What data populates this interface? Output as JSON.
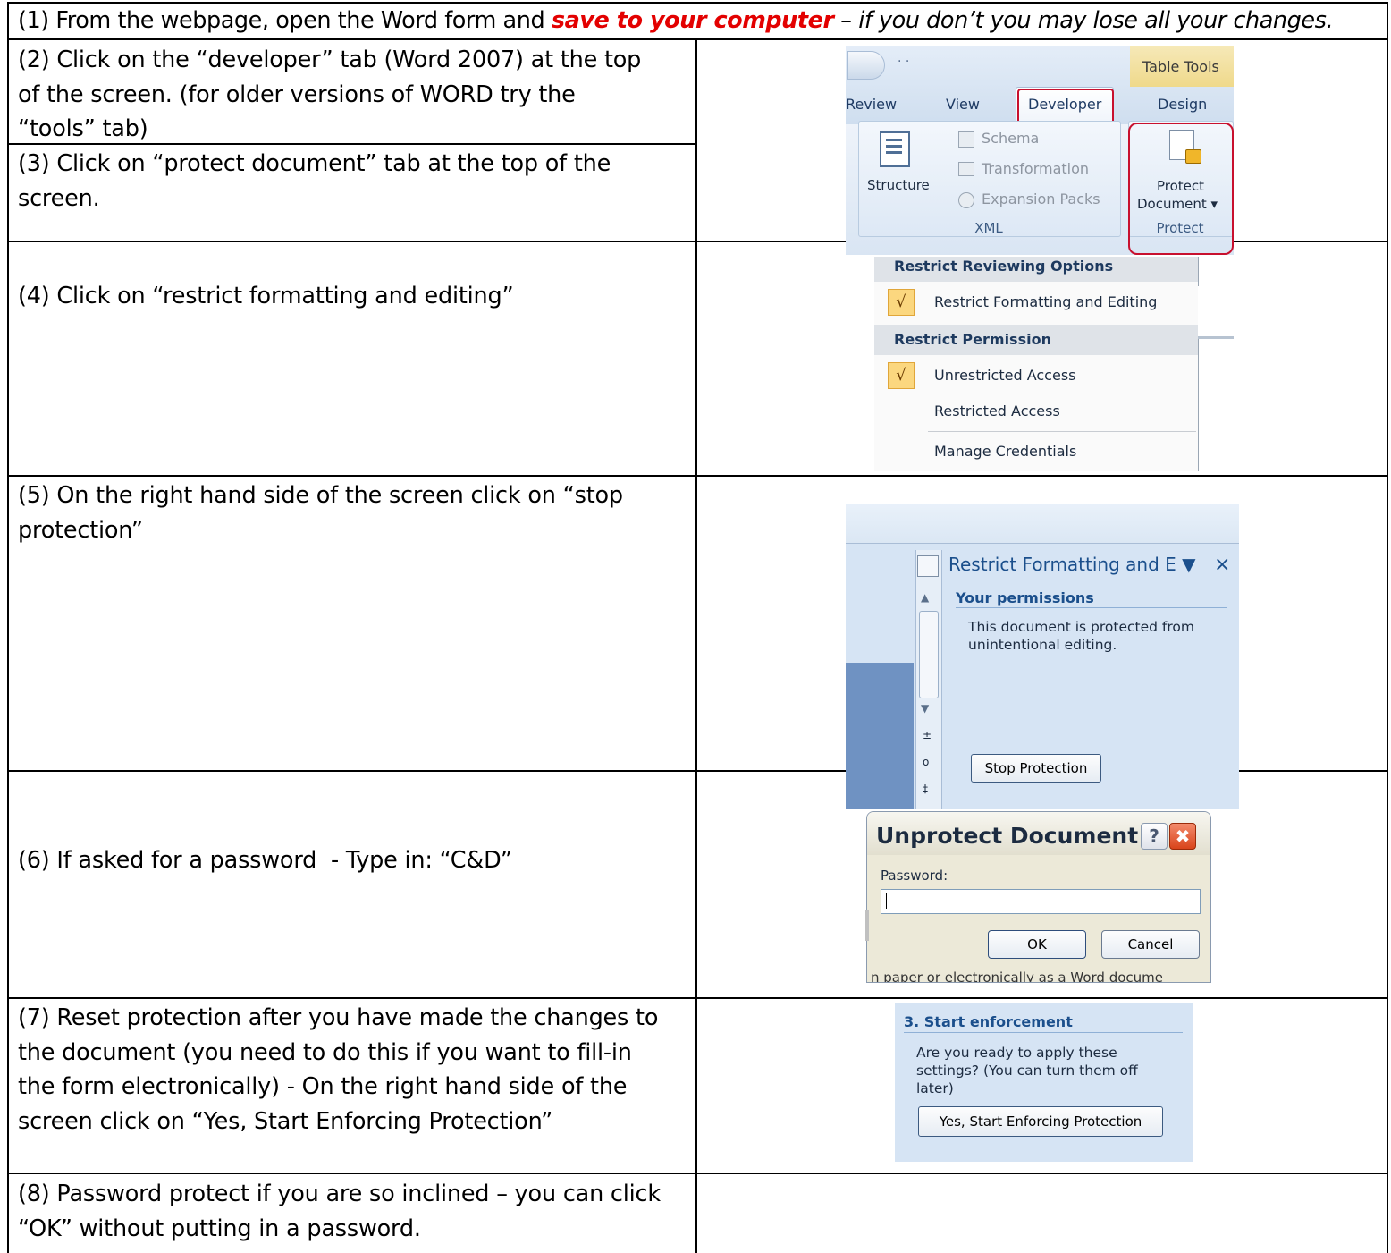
{
  "steps": {
    "step1": {
      "prefix": "(1) From the webpage, open the Word form and ",
      "emphasis": "save to your computer",
      "suffix": " – if you don’t you may lose all your changes."
    },
    "step2": {
      "line1": "(2) Click on the “developer” tab (Word 2007) at the top",
      "line2": "of the screen. (for older versions of WORD try the",
      "line3": "“tools” tab)"
    },
    "step3": {
      "line1": "(3) Click on “protect document” tab at the top of the",
      "line2": "screen."
    },
    "step4": {
      "line1": "(4) Click on “restrict formatting and editing”"
    },
    "step5": {
      "line1": "(5) On the right hand side of the screen click on “stop",
      "line2": "protection”"
    },
    "step6": {
      "line1": "(6) If asked for a password  - Type in: “C&D”"
    },
    "step7": {
      "line1": "(7) Reset protection after you have made the changes to",
      "line2": "the document (you need to do this if you want to fill-in",
      "line3": "the form electronically) - On the right hand side of the",
      "line4": "screen click on “Yes, Start Enforcing Protection”"
    },
    "step8": {
      "line1": "(8) Password protect if you are so inclined – you can click",
      "line2": "“OK” without putting in a password."
    }
  },
  "ribbon": {
    "context_label": "Table Tools",
    "tabs": [
      "Review",
      "View",
      "Developer",
      "Design"
    ],
    "xml_items": [
      "Schema",
      "Transformation",
      "Expansion Packs"
    ],
    "structure_label": "Structure",
    "xml_group": "XML",
    "protect_label_1": "Protect",
    "protect_label_2": "Document ▾",
    "protect_group": "Protect",
    "quick_access_glyph": "· ·"
  },
  "menu": {
    "header1": "Restrict Reviewing Options",
    "item1": "Restrict Formatting and Editing",
    "header2": "Restrict Permission",
    "item2": "Unrestricted Access",
    "item3": "Restricted Access",
    "item4": "Manage Credentials",
    "check": "√"
  },
  "task_pane": {
    "title": "Restrict Formatting and E ▼",
    "close": "×",
    "subtitle": "Your permissions",
    "text1": "This document is protected from",
    "text2": "unintentional editing.",
    "button": "Stop Protection"
  },
  "dialog": {
    "title": "Unprotect Document",
    "help": "?",
    "close": "✖",
    "password_label": "Password:",
    "password_value": "",
    "ok": "OK",
    "cancel": "Cancel",
    "behind_text": "n paper or electronically as a Word docume"
  },
  "enforcement": {
    "heading": "3. Start enforcement",
    "text1": "Are you ready to apply these",
    "text2": "settings? (You can turn them off",
    "text3": "later)",
    "button": "Yes, Start Enforcing Protection"
  },
  "colors": {
    "emphasis": "#e30000",
    "highlight_box": "#c8102e",
    "ribbon_blue": "#dfe9f5",
    "pane_blue": "#d6e4f4"
  }
}
